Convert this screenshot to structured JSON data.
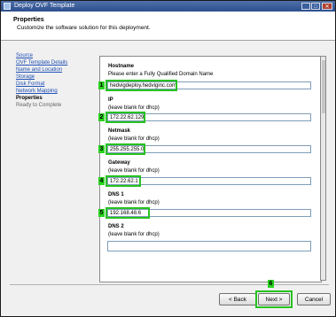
{
  "window": {
    "title": "Deploy OVF Template",
    "min": "_",
    "max": "□",
    "close": "✕"
  },
  "header": {
    "title": "Properties",
    "subtitle": "Customize the software solution for this deployment."
  },
  "nav": [
    {
      "label": "Source",
      "state": "link"
    },
    {
      "label": "OVF Template Details",
      "state": "link"
    },
    {
      "label": "Name and Location",
      "state": "link"
    },
    {
      "label": "Storage",
      "state": "link"
    },
    {
      "label": "Disk Format",
      "state": "link"
    },
    {
      "label": "Network Mapping",
      "state": "link"
    },
    {
      "label": "Properties",
      "state": "current"
    },
    {
      "label": "Ready to Complete",
      "state": "pending"
    }
  ],
  "form": {
    "hostname": {
      "label": "Hostname",
      "help": "Please enter a Fully Qualified Domain Name",
      "value": "hedvigdeploy.hedviginc.com"
    },
    "ip": {
      "label": "IP",
      "help": "(leave blank for dhcp)",
      "value": "172.22.62.129"
    },
    "netmask": {
      "label": "Netmask",
      "help": "(leave blank for dhcp)",
      "value": "255.255.255.0"
    },
    "gateway": {
      "label": "Gateway",
      "help": "(leave blank for dhcp)",
      "value": "172.22.62.1"
    },
    "dns1": {
      "label": "DNS 1",
      "help": "(leave blank for dhcp)",
      "value": "192.168.48.6"
    },
    "dns2": {
      "label": "DNS 2",
      "help": "(leave blank for dhcp)",
      "value": ""
    }
  },
  "markers": [
    "1",
    "2",
    "3",
    "4",
    "5",
    "6"
  ],
  "buttons": {
    "back": "< Back",
    "next": "Next >",
    "cancel": "Cancel"
  },
  "colors": {
    "highlight": "#26c21f",
    "titlebar": "#2c4f8f",
    "link": "#1f4fb5"
  }
}
